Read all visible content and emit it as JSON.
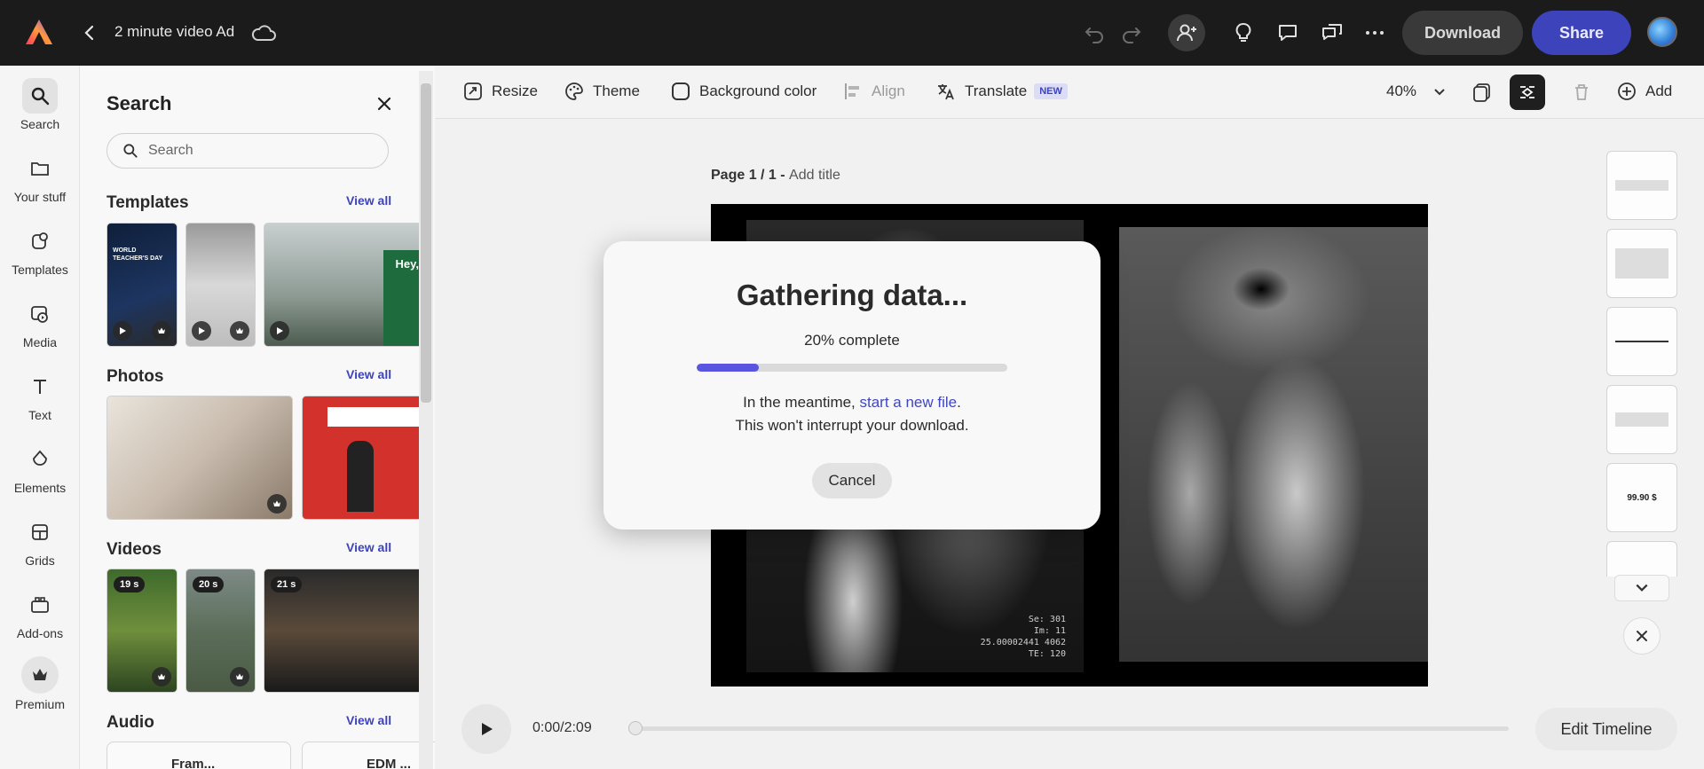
{
  "topbar": {
    "doc_title": "2 minute video Ad",
    "download_label": "Download",
    "share_label": "Share"
  },
  "rail": {
    "items": [
      {
        "label": "Search",
        "icon": "search-icon"
      },
      {
        "label": "Your stuff",
        "icon": "folder-icon"
      },
      {
        "label": "Templates",
        "icon": "templates-icon"
      },
      {
        "label": "Media",
        "icon": "media-icon"
      },
      {
        "label": "Text",
        "icon": "text-icon"
      },
      {
        "label": "Elements",
        "icon": "elements-icon"
      },
      {
        "label": "Grids",
        "icon": "grids-icon"
      },
      {
        "label": "Add-ons",
        "icon": "addons-icon"
      },
      {
        "label": "Premium",
        "icon": "crown-icon"
      }
    ]
  },
  "panel": {
    "title": "Search",
    "search_placeholder": "Search",
    "sections": {
      "templates": {
        "title": "Templates",
        "view_all": "View all",
        "thumb1_text": "WORLD TEACHER'S DAY",
        "thumb3_text": "Hey,"
      },
      "photos": {
        "title": "Photos",
        "view_all": "View all"
      },
      "videos": {
        "title": "Videos",
        "view_all": "View all",
        "durations": [
          "19 s",
          "20 s",
          "21 s"
        ]
      },
      "audio": {
        "title": "Audio",
        "view_all": "View all",
        "items": [
          "Fram...",
          "EDM ..."
        ]
      }
    }
  },
  "toolbar": {
    "resize": "Resize",
    "theme": "Theme",
    "background_color": "Background color",
    "align": "Align",
    "translate": "Translate",
    "new_badge": "NEW",
    "zoom": "40%",
    "add": "Add"
  },
  "page": {
    "label_bold": "Page 1 / 1 - ",
    "add_title": "Add title",
    "overlay_text": "Se: 301\nIm: 11\n25.00002441 4062\nTE: 120"
  },
  "page_thumbs": {
    "price": "99.90 $"
  },
  "timeline": {
    "time": "0:00/2:09",
    "progress": 0,
    "edit_label": "Edit Timeline"
  },
  "modal": {
    "title": "Gathering data...",
    "percent_text": "20% complete",
    "progress": 0.2,
    "line1_prefix": "In the meantime, ",
    "line1_link": "start a new file",
    "line1_suffix": ".",
    "line2": "This won't interrupt your download.",
    "cancel_label": "Cancel"
  },
  "colors": {
    "accent": "#3d44bb",
    "progress": "#5a55e0",
    "topbar": "#1b1b1b"
  }
}
